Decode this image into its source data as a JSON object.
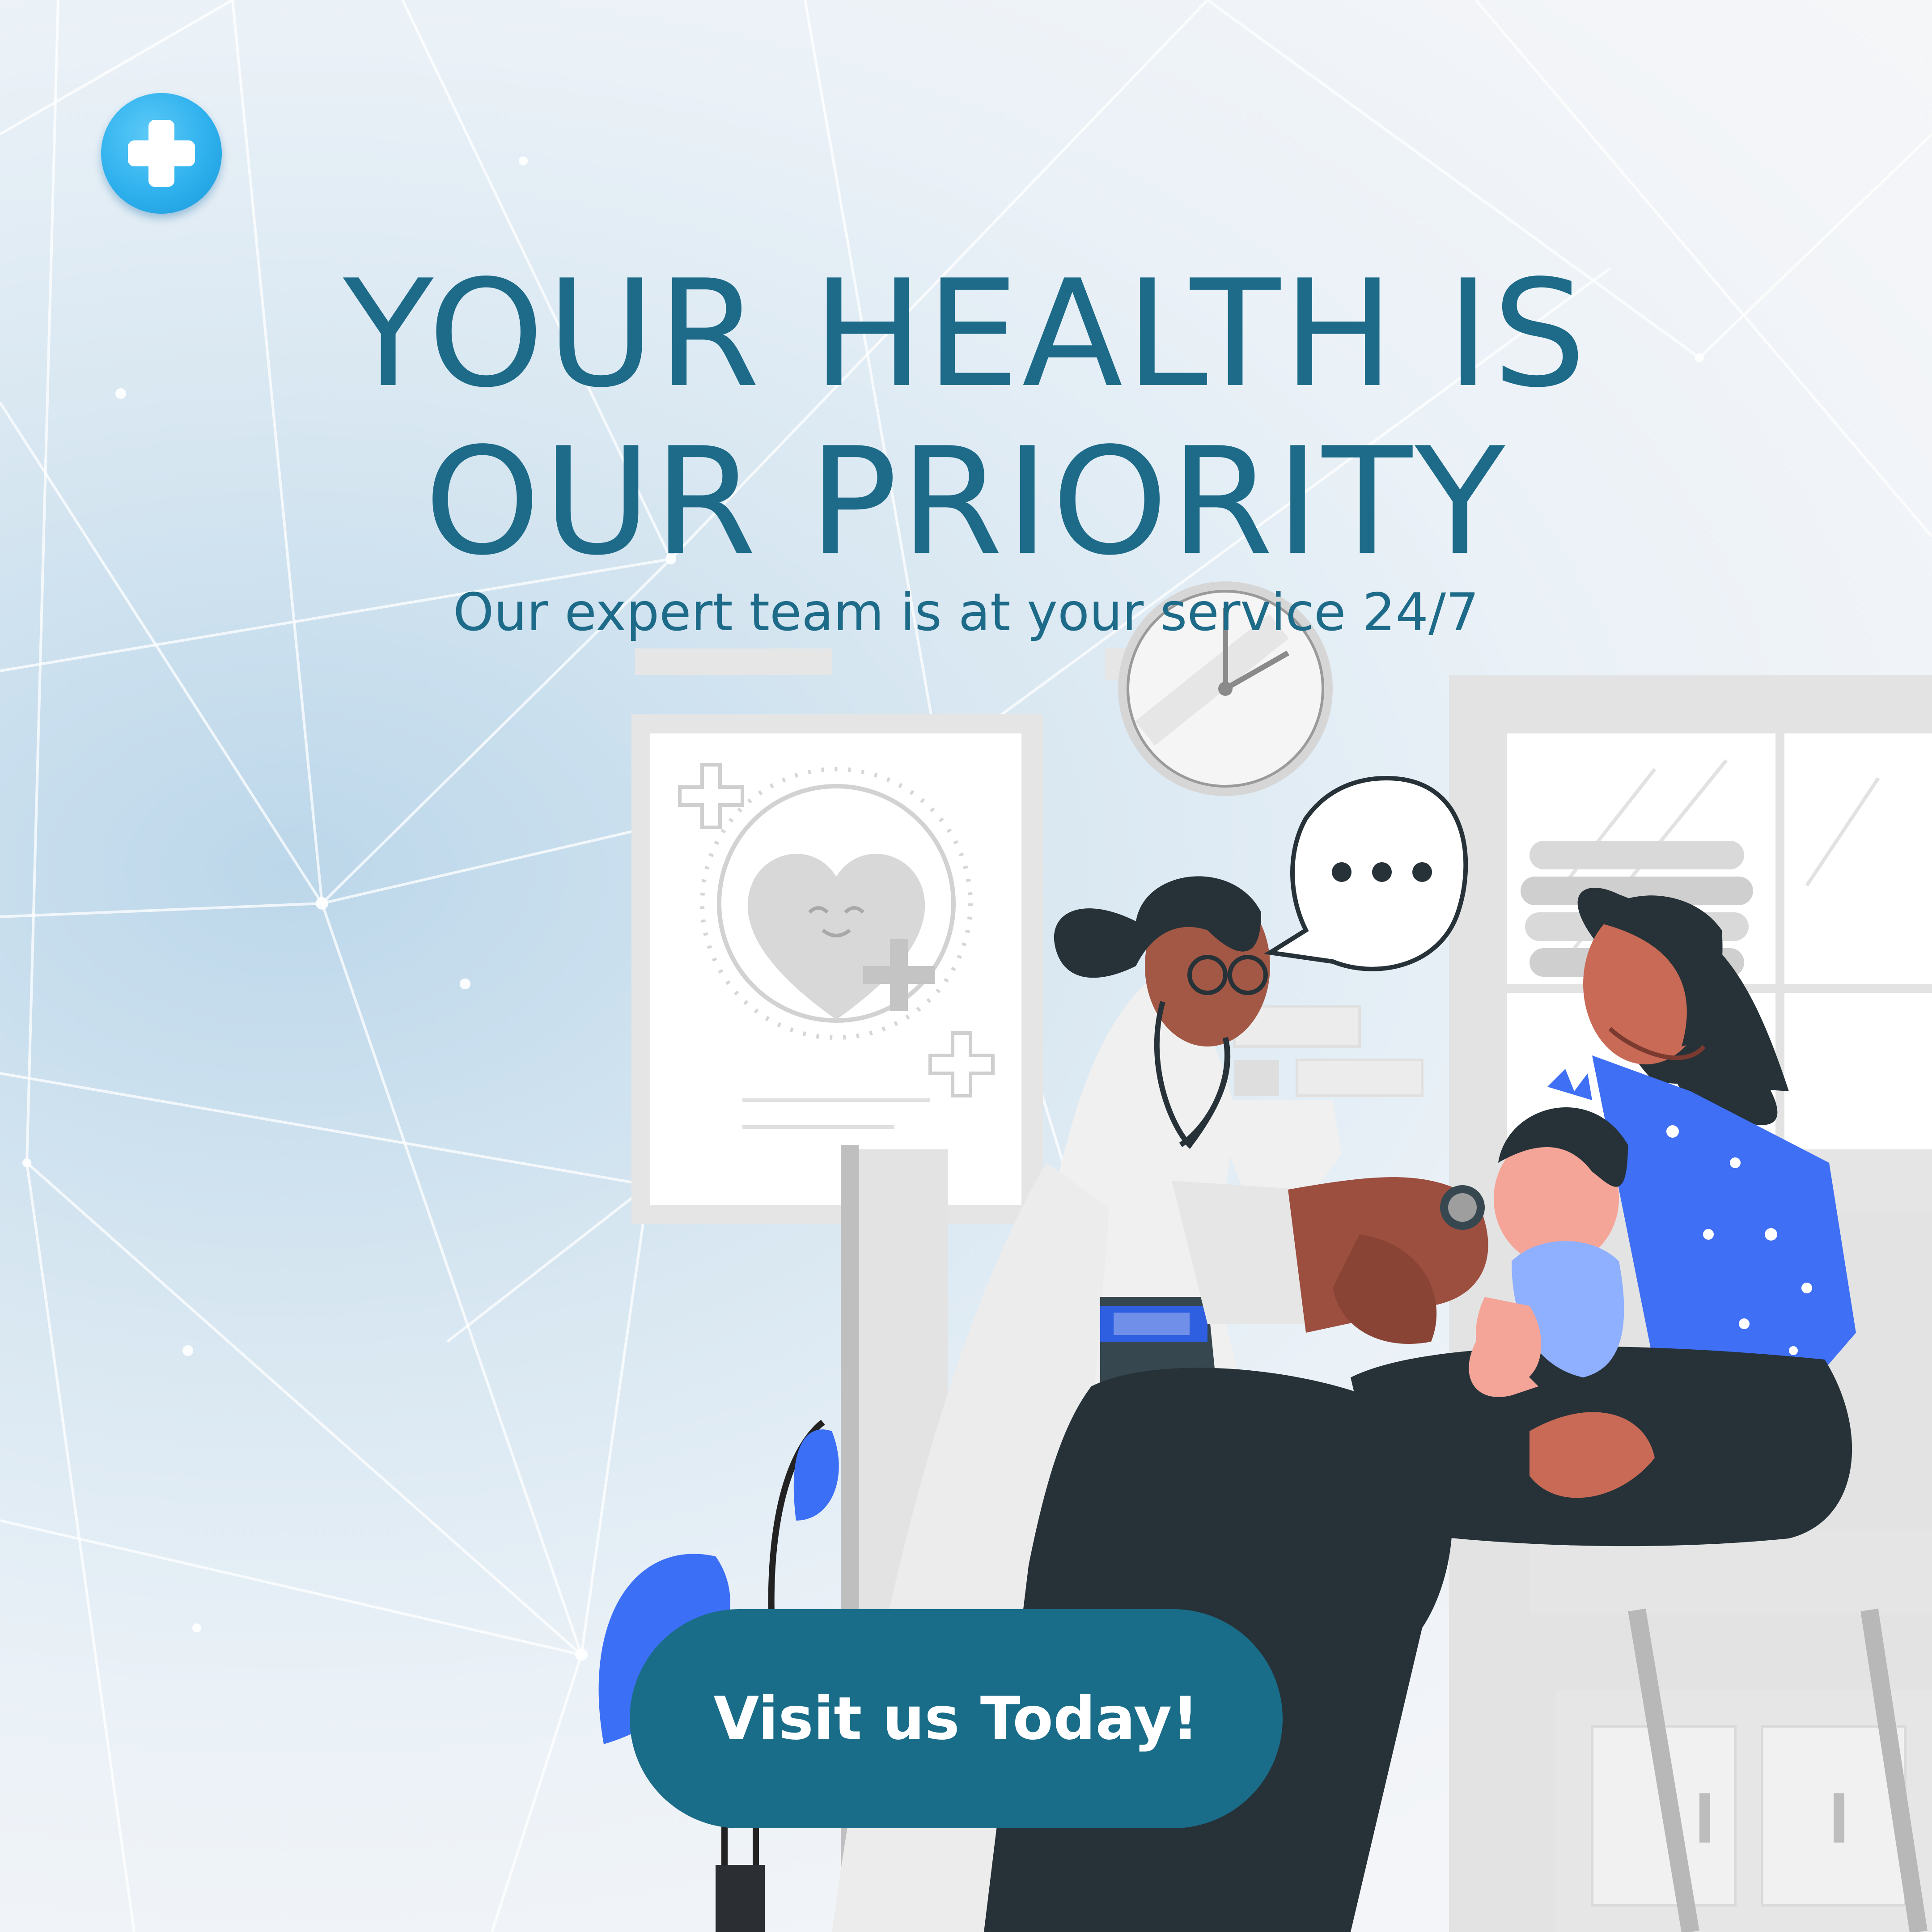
{
  "brand": {
    "logo_icon": "medical-plus-icon",
    "accent": "#2fb1ee"
  },
  "hero": {
    "headline_line1": "YOUR HEALTH IS",
    "headline_line2": "OUR PRIORITY",
    "subheadline": "Our expert team is at your service 24/7",
    "text_color": "#1d6b89"
  },
  "cta": {
    "label": "Visit us Today!",
    "background": "#1a6d89"
  },
  "illustration": {
    "speech_bubble_text": "...",
    "icons": [
      "wall-clock-icon",
      "heart-poster-icon",
      "speech-bubble-icon",
      "stethoscope-icon",
      "plant-icon"
    ]
  }
}
